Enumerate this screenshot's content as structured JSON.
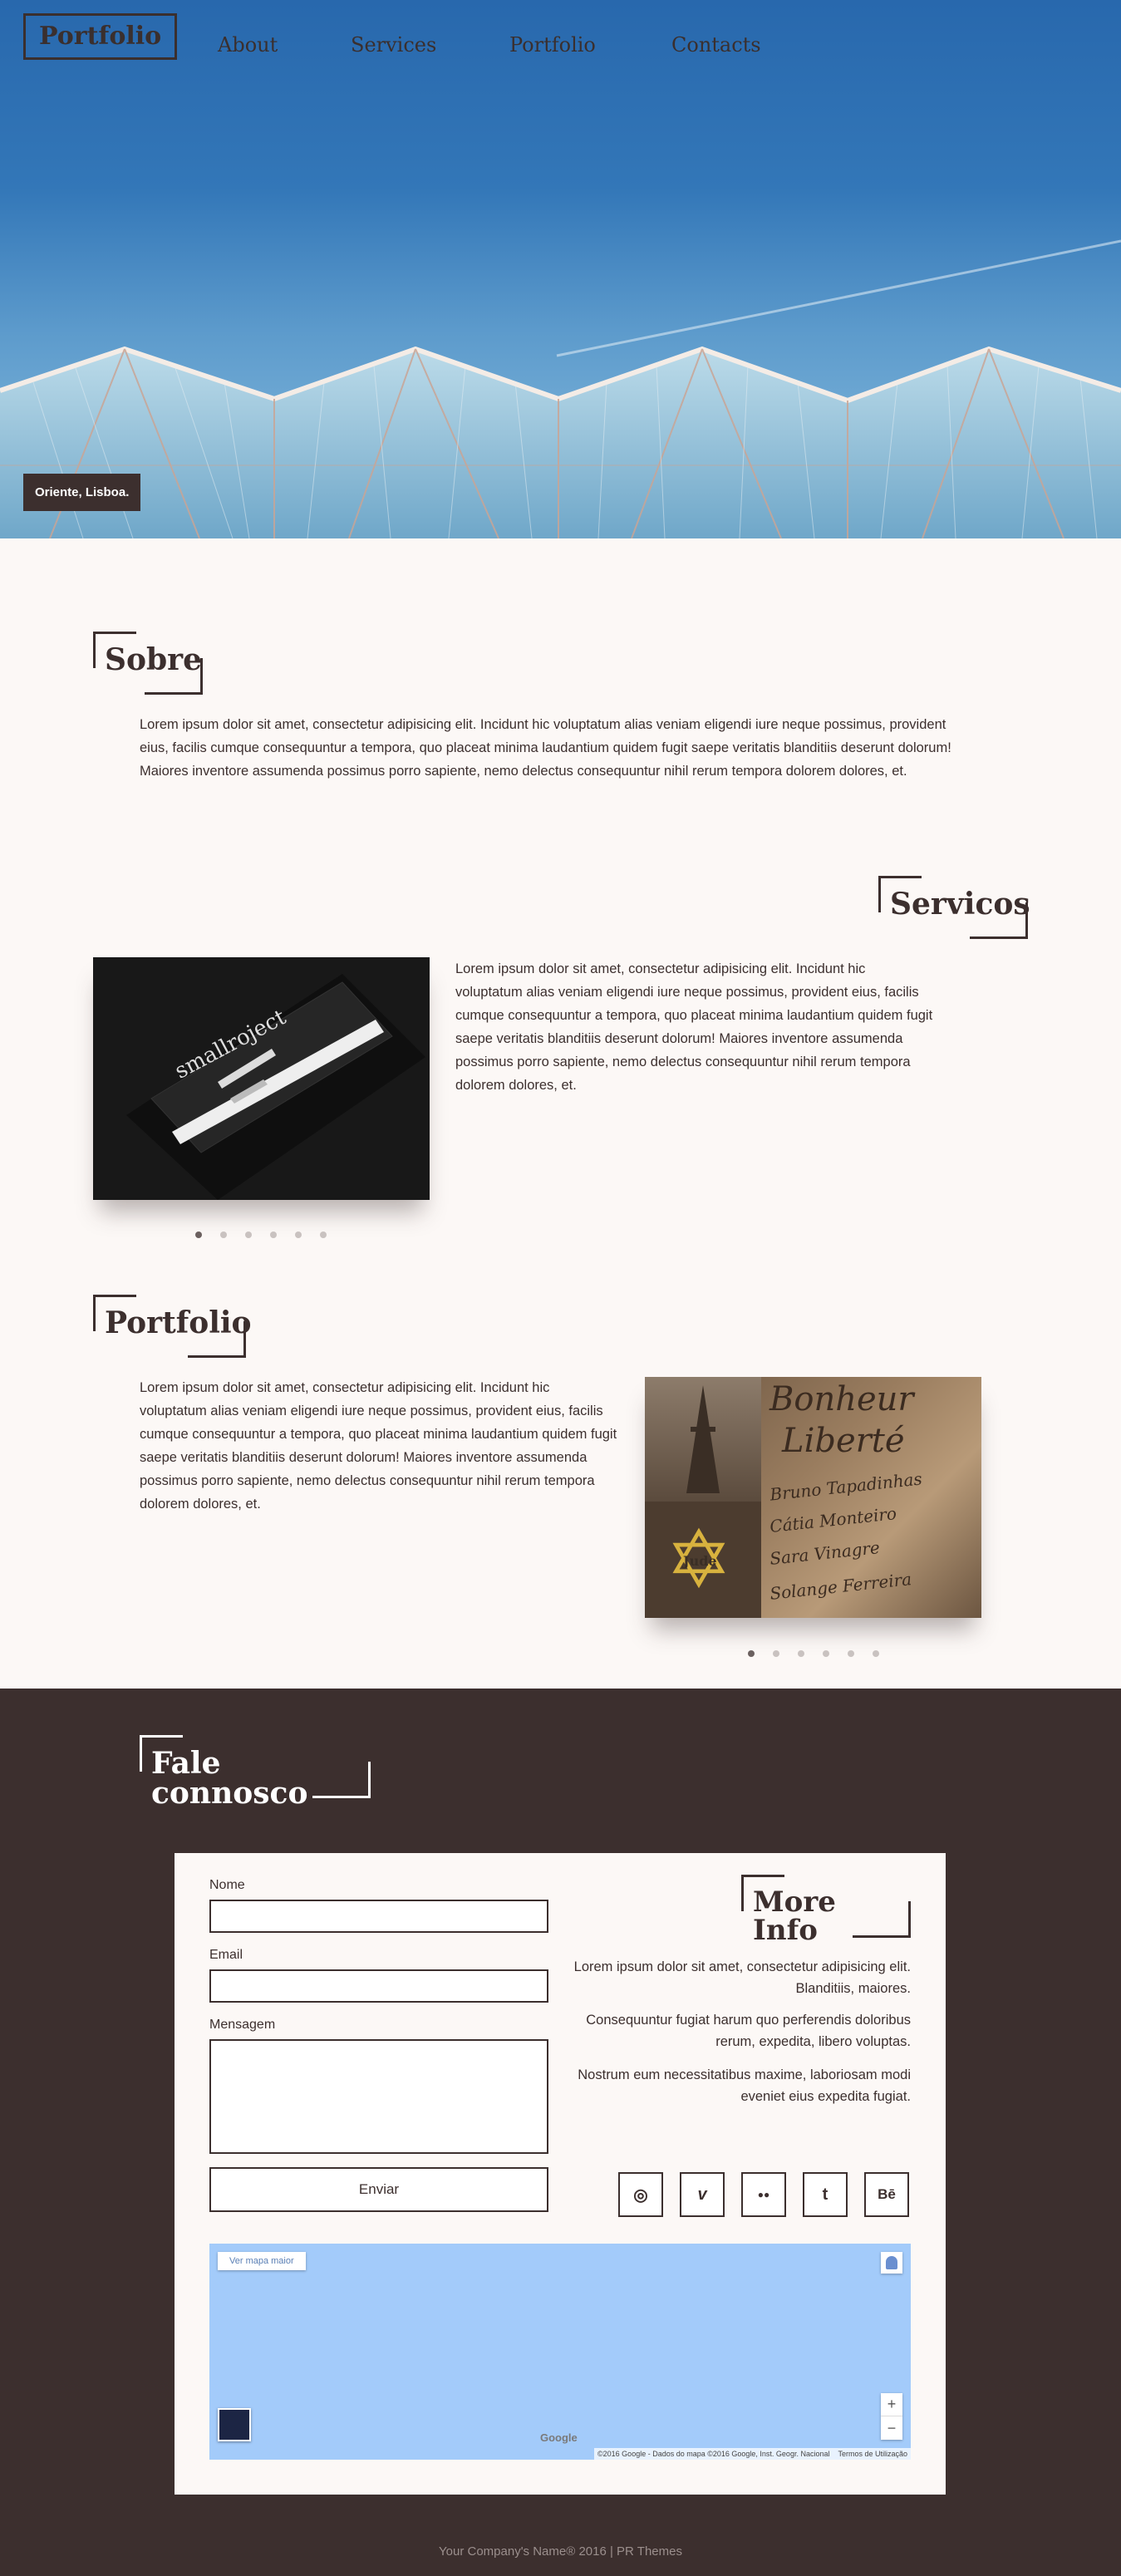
{
  "nav": {
    "brand": "Portfolio",
    "links": [
      "About",
      "Services",
      "Portfolio",
      "Contacts"
    ]
  },
  "hero": {
    "caption": "Oriente, Lisboa."
  },
  "sobre": {
    "title": "Sobre",
    "text": "Lorem ipsum dolor sit amet, consectetur adipisicing elit. Incidunt hic voluptatum alias veniam eligendi iure neque possimus, provident eius, facilis cumque consequuntur a tempora, quo placeat minima laudantium quidem fugit saepe veritatis blanditiis deserunt dolorum! Maiores inventore assumenda possimus porro sapiente, nemo delectus consequuntur nihil rerum tempora dolorem dolores, et."
  },
  "servicos": {
    "title": "Servicos",
    "text": "Lorem ipsum dolor sit amet, consectetur adipisicing elit. Incidunt hic voluptatum alias veniam eligendi iure neque possimus, provident eius, facilis cumque consequuntur a tempora, quo placeat minima laudantium quidem fugit saepe veritatis blanditiis deserunt dolorum! Maiores inventore assumenda possimus porro sapiente, nemo delectus consequuntur nihil rerum tempora dolorem dolores, et.",
    "slide_logo": "smallroject",
    "slides_count": 6,
    "active_slide": 1
  },
  "portfolio": {
    "title": "Portfolio",
    "text": "Lorem ipsum dolor sit amet, consectetur adipisicing elit. Incidunt hic voluptatum alias veniam eligendi iure neque possimus, provident eius, facilis cumque consequuntur a tempora, quo placeat minima laudantium quidem fugit saepe veritatis blanditiis deserunt dolorum! Maiores inventore assumenda possimus porro sapiente, nemo delectus consequuntur nihil rerum tempora dolorem dolores, et.",
    "slide_lines": [
      "Bonheur",
      "Liberté",
      "Bruno Tapadinhas",
      "Cátia Monteiro",
      "Sara Vinagre",
      "Solange Ferreira"
    ],
    "slide_badge": "Jude",
    "slides_count": 6,
    "active_slide": 1
  },
  "contact": {
    "title": "Fale connosco",
    "form": {
      "name_label": "Nome",
      "email_label": "Email",
      "message_label": "Mensagem",
      "submit": "Enviar"
    },
    "info": {
      "title": "More Info",
      "p1": "Lorem ipsum dolor sit amet, consectetur adipisicing elit. Blanditiis, maiores.",
      "p2": "Consequuntur fugiat harum quo perferendis doloribus rerum, expedita, libero voluptas.",
      "p3": "Nostrum eum necessitatibus maxime, laboriosam modi eveniet eius expedita fugiat."
    },
    "social": [
      {
        "icon": "dribbble-icon",
        "glyph": "◎"
      },
      {
        "icon": "vimeo-icon",
        "glyph": "v"
      },
      {
        "icon": "flickr-icon",
        "glyph": "●●"
      },
      {
        "icon": "tumblr-icon",
        "glyph": "t"
      },
      {
        "icon": "behance-icon",
        "glyph": "Bē"
      }
    ],
    "map": {
      "larger_map": "Ver mapa maior",
      "zoom_in": "+",
      "zoom_out": "−",
      "google": "Google",
      "attribution": "©2016 Google - Dados do mapa ©2016 Google, Inst. Geogr. Nacional",
      "terms": "Termos de Utilização",
      "water_color": "#a3cbfa"
    }
  },
  "footer": {
    "text": "Your Company's Name® 2016  |  PR Themes"
  },
  "colors": {
    "dark": "#3c2f2e",
    "background": "#fcf8f6",
    "sky": "#2868ad"
  }
}
